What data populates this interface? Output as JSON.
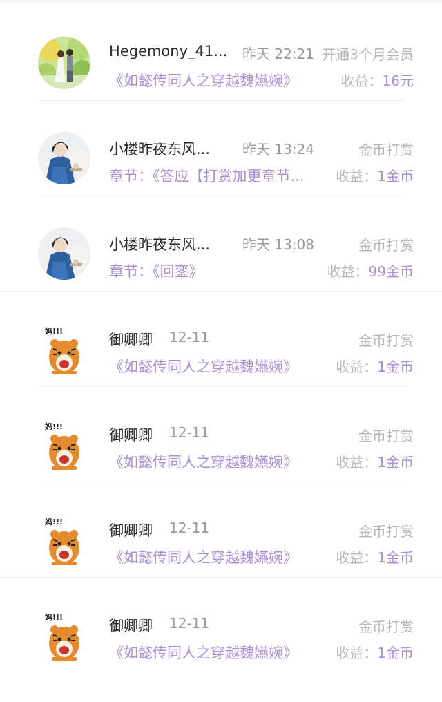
{
  "records": [
    {
      "user": "Hegemony_41...",
      "time": "昨天 22:21",
      "type": "开通3个月会员",
      "detail": "《如懿传同人之穿越魏嬿婉》",
      "earnings_label": "收益：",
      "earnings_value": "16元",
      "avatar": "photo-avatar-icon"
    },
    {
      "user": "小楼昨夜东风...",
      "time": "昨天 13:24",
      "type": "金币打赏",
      "detail": "章节：《答应【打赏加更章节...",
      "earnings_label": "收益：",
      "earnings_value": "1金币",
      "avatar": "costume-avatar-icon"
    },
    {
      "user": "小楼昨夜东风...",
      "time": "昨天 13:08",
      "type": "金币打赏",
      "detail": "章节：《回銮》",
      "earnings_label": "收益：",
      "earnings_value": "99金币",
      "avatar": "costume-avatar-icon"
    },
    {
      "user": "御卿卿",
      "time": "12-11",
      "type": "金币打赏",
      "detail": "《如懿传同人之穿越魏嬿婉》",
      "earnings_label": "收益：",
      "earnings_value": "1金币",
      "avatar": "tiger-sticker-icon",
      "sticker_text": "妈!!!"
    },
    {
      "user": "御卿卿",
      "time": "12-11",
      "type": "金币打赏",
      "detail": "《如懿传同人之穿越魏嬿婉》",
      "earnings_label": "收益：",
      "earnings_value": "1金币",
      "avatar": "tiger-sticker-icon",
      "sticker_text": "妈!!!"
    },
    {
      "user": "御卿卿",
      "time": "12-11",
      "type": "金币打赏",
      "detail": "《如懿传同人之穿越魏嬿婉》",
      "earnings_label": "收益：",
      "earnings_value": "1金币",
      "avatar": "tiger-sticker-icon",
      "sticker_text": "妈!!!"
    },
    {
      "user": "御卿卿",
      "time": "12-11",
      "type": "金币打赏",
      "detail": "《如懿传同人之穿越魏嬿婉》",
      "earnings_label": "收益：",
      "earnings_value": "1金币",
      "avatar": "tiger-sticker-icon",
      "sticker_text": "妈!!!"
    }
  ],
  "colors": {
    "accent_purple": "#ab8fd5",
    "muted_gray": "#b5b5b5",
    "name_dark": "#2b2b2b"
  }
}
